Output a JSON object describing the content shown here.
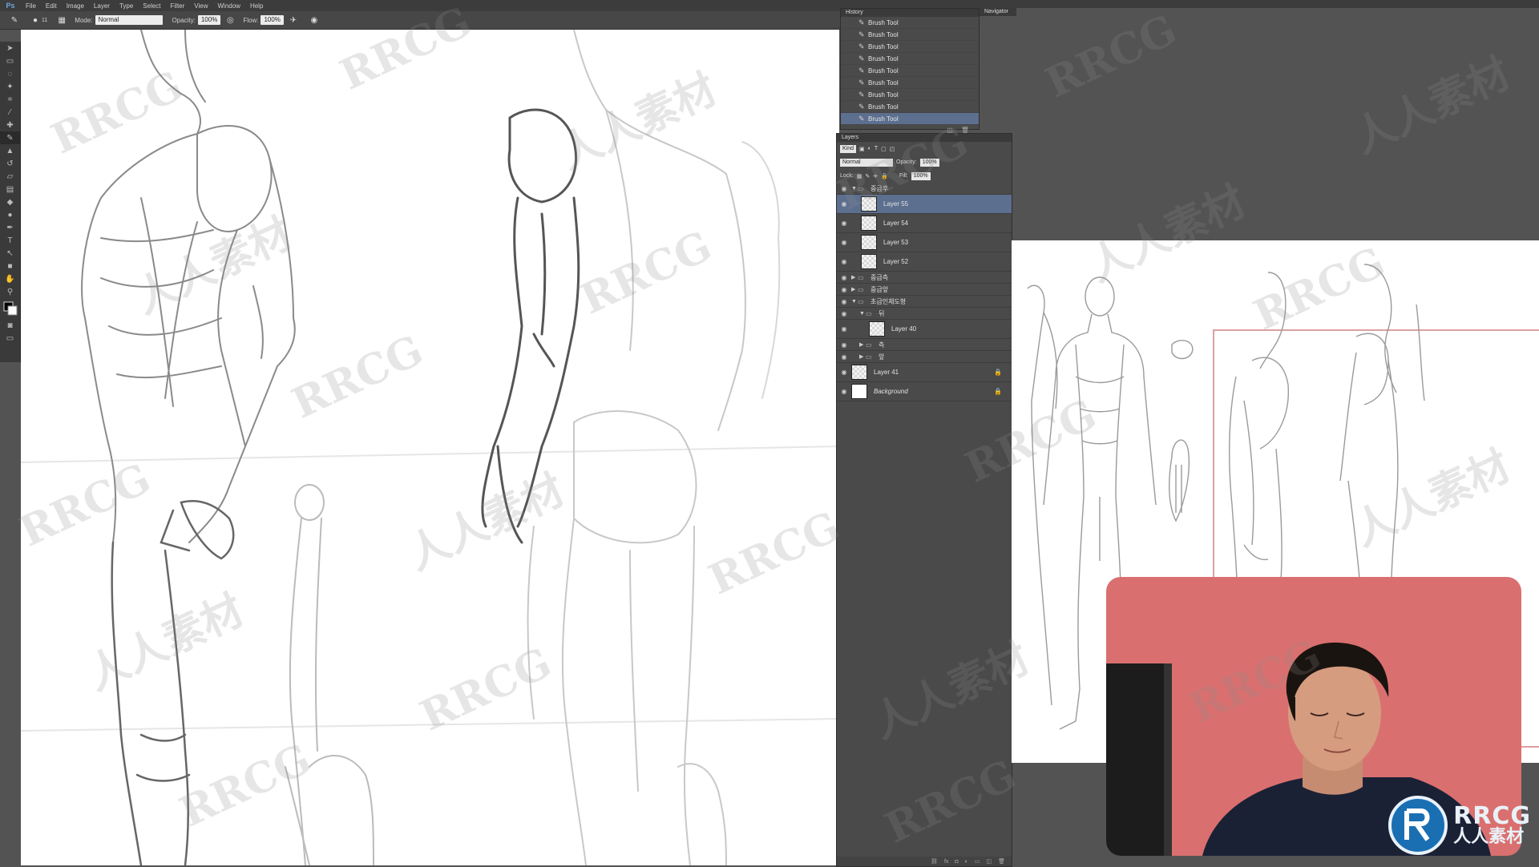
{
  "app": {
    "logo": "Ps"
  },
  "menu": [
    "File",
    "Edit",
    "Image",
    "Layer",
    "Type",
    "Select",
    "Filter",
    "View",
    "Window",
    "Help"
  ],
  "options": {
    "brush_size": "11",
    "mode_label": "Mode:",
    "mode_value": "Normal",
    "opacity_label": "Opacity:",
    "opacity_value": "100%",
    "flow_label": "Flow:",
    "flow_value": "100%"
  },
  "history": {
    "tab": "History",
    "items": [
      "Brush Tool",
      "Brush Tool",
      "Brush Tool",
      "Brush Tool",
      "Brush Tool",
      "Brush Tool",
      "Brush Tool",
      "Brush Tool",
      "Brush Tool"
    ],
    "selected_index": 8
  },
  "navigator": {
    "tab": "Navigator"
  },
  "layers": {
    "tab": "Layers",
    "kind_label": "Kind",
    "blend_mode": "Normal",
    "opacity_label": "Opacity:",
    "opacity_value": "100%",
    "lock_label": "Lock:",
    "fill_label": "Fill:",
    "fill_value": "100%",
    "group_top": "중급후",
    "layer55": "Layer 55",
    "layer54": "Layer 54",
    "layer53": "Layer 53",
    "layer52": "Layer 52",
    "group_2": "중급측",
    "group_3": "중급앞",
    "group_4": "초급인체도형",
    "sub_group_1": "뒤",
    "layer40": "Layer 40",
    "sub_group_2": "측",
    "sub_group_3": "앞",
    "layer41": "Layer 41",
    "background": "Background"
  },
  "watermark": {
    "text_1": "RRCG",
    "text_2": "人人素材"
  },
  "logo": {
    "line1": "RRCG",
    "line2": "人人素材"
  },
  "colors": {
    "selection": "#5d6f8f",
    "panel": "#4a4a4a",
    "webcam_bg": "#d9706f"
  }
}
